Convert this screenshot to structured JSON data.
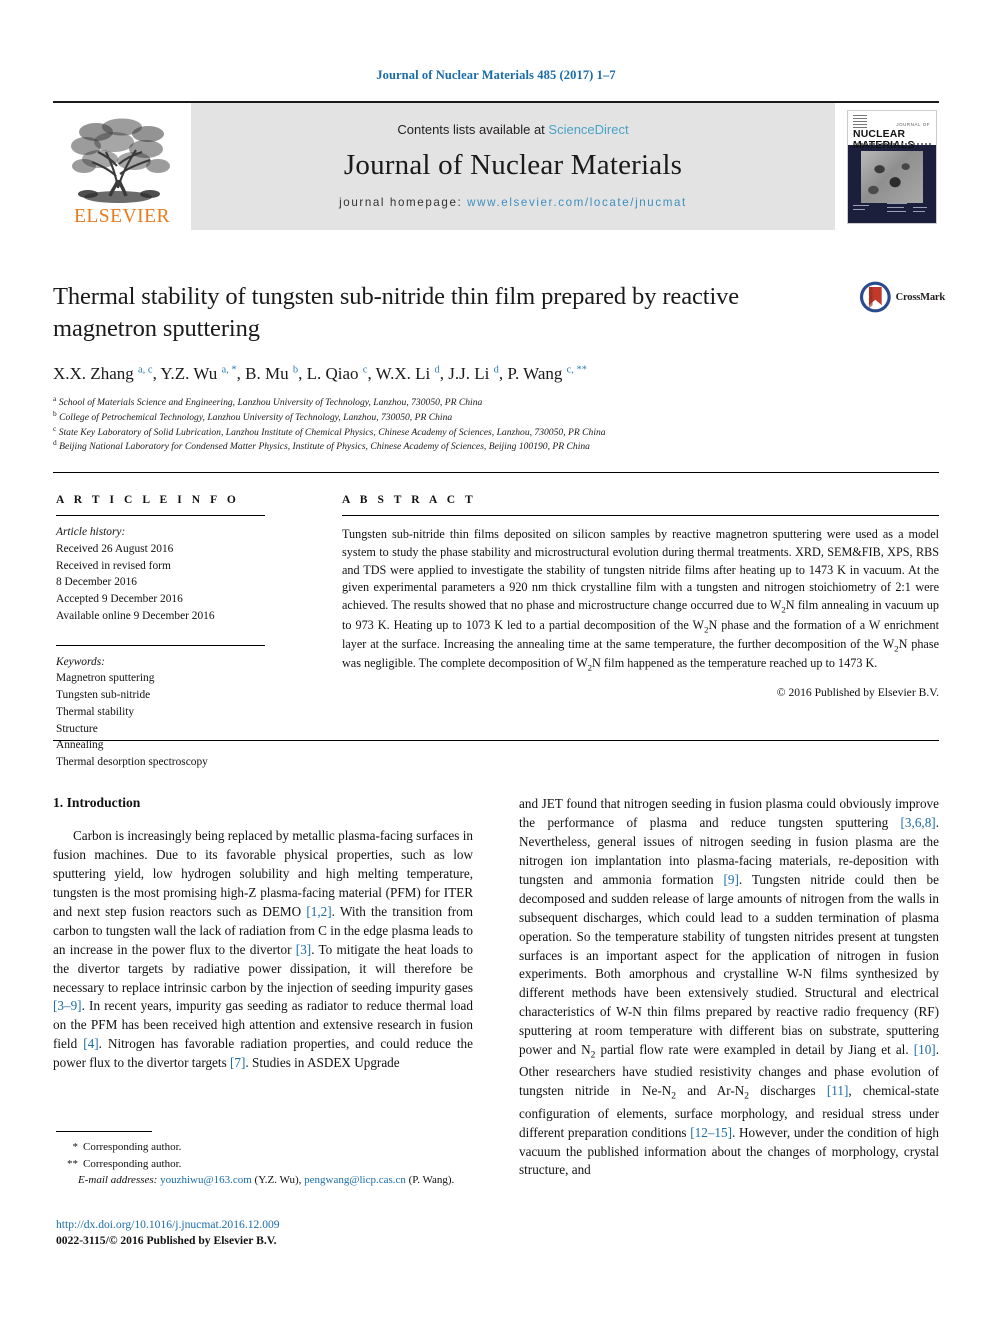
{
  "running_head": "Journal of Nuclear Materials 485 (2017) 1–7",
  "masthead": {
    "contents_prefix": "Contents lists available at ",
    "sciencedirect": "ScienceDirect",
    "journal_title": "Journal of Nuclear Materials",
    "homepage_label": "journal homepage: ",
    "homepage_url": "www.elsevier.com/locate/jnucmat",
    "publisher_wordmark": "ELSEVIER",
    "cover": {
      "publisher_mark": "ELSEVIER",
      "line_small": "JOURNAL OF",
      "line_big": "NUCLEAR MATERIALS"
    },
    "link_color": "#4aa3c7",
    "band_color": "#e3e3e3",
    "brand_orange": "#E87B1E"
  },
  "crossmark": {
    "label": "CrossMark"
  },
  "article": {
    "title": "Thermal stability of tungsten sub-nitride thin film prepared by reactive magnetron sputtering",
    "authors_html": "X.X. Zhang <sup>a, c</sup>, Y.Z. Wu <sup>a, *</sup>, B. Mu <sup>b</sup>, L. Qiao <sup>c</sup>, W.X. Li <sup>d</sup>, J.J. Li <sup>d</sup>, P. Wang <sup>c, **</sup>",
    "affiliations": [
      {
        "marker": "a",
        "text": "School of Materials Science and Engineering, Lanzhou University of Technology, Lanzhou, 730050, PR China"
      },
      {
        "marker": "b",
        "text": "College of Petrochemical Technology, Lanzhou University of Technology, Lanzhou, 730050, PR China"
      },
      {
        "marker": "c",
        "text": "State Key Laboratory of Solid Lubrication, Lanzhou Institute of Chemical Physics, Chinese Academy of Sciences, Lanzhou, 730050, PR China"
      },
      {
        "marker": "d",
        "text": "Beijing National Laboratory for Condensed Matter Physics, Institute of Physics, Chinese Academy of Sciences, Beijing 100190, PR China"
      }
    ]
  },
  "article_info": {
    "heading": "A R T I C L E   I N F O",
    "history_label": "Article history:",
    "history": [
      "Received 26 August 2016",
      "Received in revised form",
      "8 December 2016",
      "Accepted 9 December 2016",
      "Available online 9 December 2016"
    ],
    "keywords_label": "Keywords:",
    "keywords": [
      "Magnetron sputtering",
      "Tungsten sub-nitride",
      "Thermal stability",
      "Structure",
      "Annealing",
      "Thermal desorption spectroscopy"
    ]
  },
  "abstract": {
    "heading": "A B S T R A C T",
    "body_html": "Tungsten sub-nitride thin films deposited on silicon samples by reactive magnetron sputtering were used as a model system to study the phase stability and microstructural evolution during thermal treatments. XRD, SEM&amp;FIB, XPS, RBS and TDS were applied to investigate the stability of tungsten nitride films after heating up to 1473 K in vacuum. At the given experimental parameters a 920 nm thick crystalline film with a tungsten and nitrogen stoichiometry of 2:1 were achieved. The results showed that no phase and microstructure change occurred due to W<sub>2</sub>N film annealing in vacuum up to 973 K. Heating up to 1073 K led to a partial decomposition of the W<sub>2</sub>N phase and the formation of a W enrichment layer at the surface. Increasing the annealing time at the same temperature, the further decomposition of the W<sub>2</sub>N phase was negligible. The complete decomposition of W<sub>2</sub>N film happened as the temperature reached up to 1473 K.",
    "copyright": "© 2016 Published by Elsevier B.V."
  },
  "body": {
    "section_number_title": "1.  Introduction",
    "left_paragraph_html": "Carbon is increasingly being replaced by metallic plasma-facing surfaces in fusion machines. Due to its favorable physical properties, such as low sputtering yield, low hydrogen solubility and high melting temperature, tungsten is the most promising high-Z plasma-facing material (PFM) for ITER and next step fusion reactors such as DEMO <span class=\"ref\">[1,2]</span>. With the transition from carbon to tungsten wall the lack of radiation from C in the edge plasma leads to an increase in the power flux to the divertor <span class=\"ref\">[3]</span>. To mitigate the heat loads to the divertor targets by radiative power dissipation, it will therefore be necessary to replace intrinsic carbon by the injection of seeding impurity gases <span class=\"ref\">[3–9]</span>. In recent years, impurity gas seeding as radiator to reduce thermal load on the PFM has been received high attention and extensive research in fusion field <span class=\"ref\">[4]</span>. Nitrogen has favorable radiation properties, and could reduce the power flux to the divertor targets <span class=\"ref\">[7]</span>. Studies in ASDEX Upgrade",
    "right_paragraph_html": "and JET found that nitrogen seeding in fusion plasma could obviously improve the performance of plasma and reduce tungsten sputtering <span class=\"ref\">[3,6,8]</span>. Nevertheless, general issues of nitrogen seeding in fusion plasma are the nitrogen ion implantation into plasma-facing materials, re-deposition with tungsten and ammonia formation <span class=\"ref\">[9]</span>. Tungsten nitride could then be decomposed and sudden release of large amounts of nitrogen from the walls in subsequent discharges, which could lead to a sudden termination of plasma operation. So the temperature stability of tungsten nitrides present at tungsten surfaces is an important aspect for the application of nitrogen in fusion experiments. Both amorphous and crystalline W-N films synthesized by different methods have been extensively studied. Structural and electrical characteristics of W-N thin films prepared by reactive radio frequency (RF) sputtering at room temperature with different bias on substrate, sputtering power and N<sub>2</sub> partial flow rate were exampled in detail by Jiang et al. <span class=\"ref\">[10]</span>. Other researchers have studied resistivity changes and phase evolution of tungsten nitride in Ne-N<sub>2</sub> and Ar-N<sub>2</sub> discharges <span class=\"ref\">[11]</span>, chemical-state configuration of elements, surface morphology, and residual stress under different preparation conditions <span class=\"ref\">[12–15]</span>. However, under the condition of high vacuum the published information about the changes of morphology, crystal structure, and"
  },
  "footnotes": {
    "corresponding_single": "Corresponding author.",
    "corresponding_double": "Corresponding author.",
    "email_label": "E-mail addresses:",
    "email1": "youzhiwu@163.com",
    "email1_name": "(Y.Z. Wu)",
    "email2": "pengwang@licp.cas.cn",
    "email2_name": "(P. Wang).",
    "doi": "http://dx.doi.org/10.1016/j.jnucmat.2016.12.009",
    "issn_line": "0022-3115/© 2016 Published by Elsevier B.V."
  }
}
